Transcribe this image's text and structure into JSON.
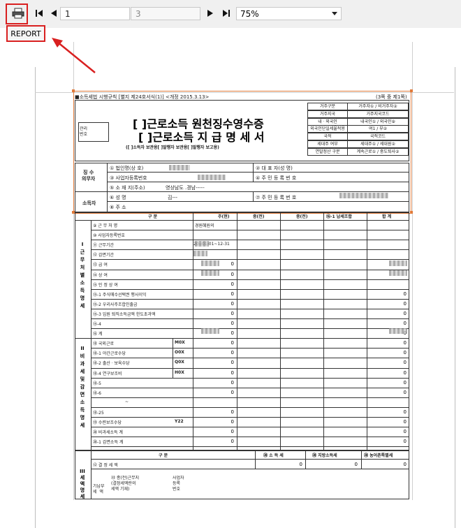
{
  "toolbar": {
    "current_page": "1",
    "total_pages": "3",
    "zoom": "75%",
    "report_tab": "REPORT",
    "icons": [
      "printer-icon",
      "first-page-icon",
      "prev-page-icon",
      "next-page-icon",
      "last-page-icon",
      "dropdown-icon"
    ]
  },
  "form": {
    "header_left": "■소득세법 시행규칙 [별지 제24호서식(1)] <개정 2015.3.13>",
    "header_right": "(3쪽 중 제1쪽)",
    "manage_no_label": "관리\n번호",
    "title1": "[   ]근로소득 원천징수영수증",
    "title2": "[   ]근로소득 지 급 명 세 서",
    "subtitle": "([     ]소득자 보관용[     ]발행자 보관용[     ]발행자 보고용)",
    "right_info": [
      [
        "거주구분",
        "거주자① / 비거주자②"
      ],
      [
        "거주지국",
        "거주지국코드"
      ],
      [
        "내ㆍ외국인",
        "내국인① / 외국인⑨"
      ],
      [
        "외국인단일세율적용",
        "여1 / 부②"
      ],
      [
        "국적",
        "국적코드"
      ],
      [
        "세대주 여부",
        "세대주① / 세대원②"
      ],
      [
        "연말정산 구분",
        "계속근로① / 중도퇴사②"
      ]
    ],
    "payer_label": "징 수\n의무자",
    "payer_rows": [
      "① 법인명(상 호)",
      "③ 사업자등록번호",
      "⑤ 소 재 지(주소)"
    ],
    "payer_right": [
      "② 대 표 자(성 명)",
      "④ 주 민 등 록 번 호"
    ],
    "address_value": "영상남도 .경남-----",
    "earner_label": "소득자",
    "earner_rows": [
      "⑥ 성          명",
      "⑧ 주          소"
    ],
    "earner_name_value": "김---",
    "earner_right": "⑦ 주 민 등 록 번 호",
    "income_header": [
      "구   분",
      "주(현)",
      "종(전)",
      "종(전)",
      "⑯-1 납세조합",
      "합  계"
    ],
    "section1_label": "I\n근\n무\n처\n별\n소\n득\n명\n세",
    "section1_rows": [
      "⑨ 근 무 처 명",
      "⑩ 사업자등록번호",
      "⑪ 근무기간",
      "⑫ 감면기간",
      "⑬ 급          여",
      "⑭ 상          여",
      "⑮ 인 정 상 여",
      "⑮-1 주식매수선택권 행사이익",
      "⑮-2 우리사주조합인출금",
      "⑮-3 임원 퇴직소득금액 한도초과액",
      "⑮-4",
      "⑯ 계"
    ],
    "workplace_value": "경원혜원의",
    "period_value": "20--01-01~12-31",
    "section2_label": "II\n비\n과\n세\n및\n감\n면\n소\n득\n명\n세",
    "section2_rows": [
      "⑱ 국외근로",
      "⑱-1 야간근로수당",
      "⑱-2 출산ㆍ보육수당",
      "⑱-4 연구보조비",
      "⑱-5",
      "⑱-6",
      "~",
      "⑱-25",
      "⑲ 수련보조수당",
      "⑳ 비과세소득 계",
      "⑳-1 감면소득 계"
    ],
    "section2_codes": [
      "M0X",
      "O0X",
      "Q0X",
      "H0X",
      "",
      "",
      "",
      "",
      "Y22",
      "",
      ""
    ],
    "zero": "0",
    "section3_label": "III\n세\n액\n명\n세",
    "tax_header": [
      "구      분",
      "⑳ 소 득 세",
      "⑳ 지방소득세",
      "⑳ 농어촌특별세"
    ],
    "tax_row1": "⑫ 결  정  세  액",
    "tax_row2_a": "기납부\n세  액",
    "tax_row2_b": "㉓ 종(전)근무지\n(결정세액란의\n세액 기재)",
    "tax_row2_c": "사업자\n등록\n번호"
  },
  "colors": {
    "highlight": "#d92020",
    "selection": "#e07a3a"
  }
}
